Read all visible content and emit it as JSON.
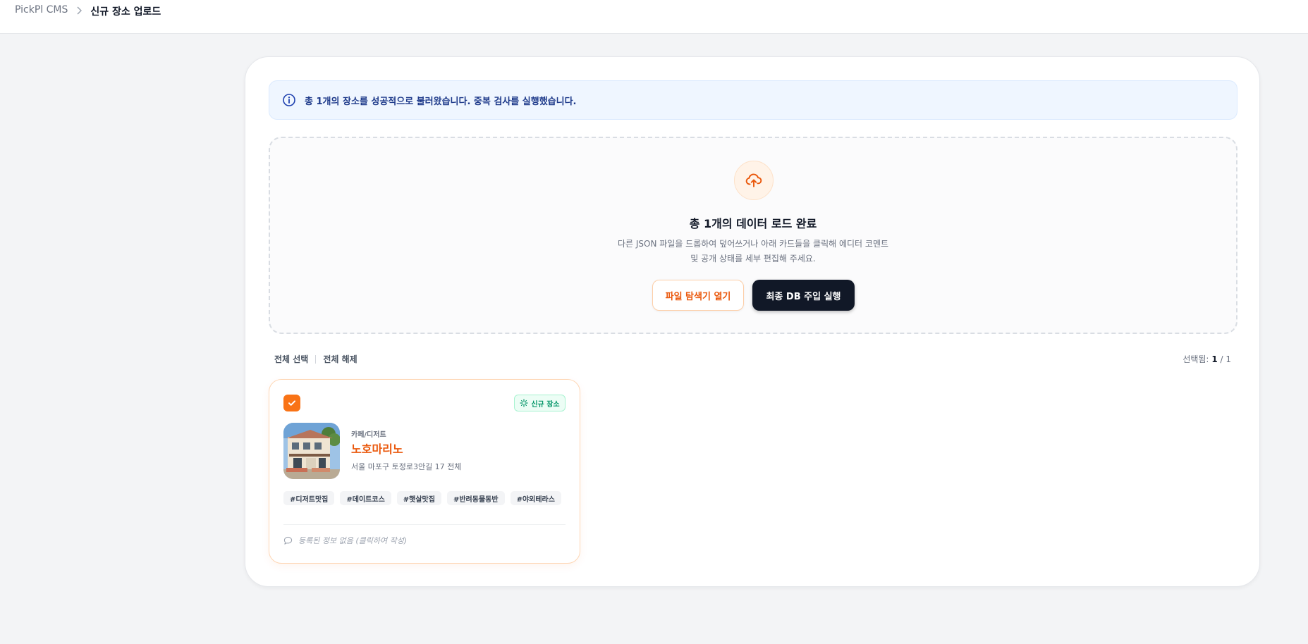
{
  "breadcrumb": {
    "root": "PickPl CMS",
    "current": "신규 장소 업로드"
  },
  "alert": {
    "message": "총 1개의 장소를 성공적으로 불러왔습니다. 중복 검사를 실행했습니다.",
    "icon": "info-icon"
  },
  "dropzone": {
    "icon": "upload-cloud-icon",
    "title": "총 1개의 데이터 로드 완료",
    "desc_line1": "다른 JSON 파일을 드롭하여 덮어쓰거나 아래 카드들을 클릭해 에디터 코멘트",
    "desc_line2": "및 공개 상태를 세부 편집해 주세요.",
    "open_button": "파일 탐색기 열기",
    "exec_button": "최종 DB 주입 실행"
  },
  "selection": {
    "select_all": "전체 선택",
    "deselect_all": "전체 해제",
    "count_label": "선택됨:",
    "selected": "1",
    "total": "/ 1"
  },
  "cards": [
    {
      "checked": true,
      "badge": "신규 장소",
      "badge_icon": "sparkle-icon",
      "category": "카페/디저트",
      "name": "노호마리노",
      "address": "서울 마포구 토정로3안길 17 전체",
      "tags": [
        "#디저트맛집",
        "#데이트코스",
        "#햇살맛집",
        "#반려동물동반",
        "#야외테라스"
      ],
      "comment": "등록된 정보 없음 (클릭하여 작성)",
      "comment_icon": "chat-bubble-icon"
    }
  ],
  "colors": {
    "accent": "#ea580c",
    "accent_bg": "#f97316",
    "dark_button": "#111827",
    "alert_bg": "#eff6ff",
    "success": "#059669"
  }
}
